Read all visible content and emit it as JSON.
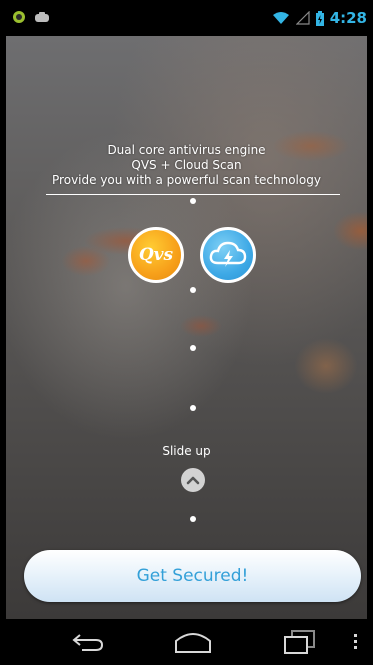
{
  "status_bar": {
    "time": "4:28",
    "icons": [
      "android-notification-icon",
      "controller-notification-icon",
      "wifi-icon",
      "signal-icon",
      "battery-icon"
    ]
  },
  "promo": {
    "line1": "Dual core antivirus engine",
    "line2": "QVS + Cloud Scan",
    "line3": "Provide you with a powerful scan technology"
  },
  "logos": {
    "qvs_label": "Qvs",
    "cloud_icon": "cloud-lightning-icon"
  },
  "slide": {
    "label": "Slide up",
    "icon": "chevron-up-icon"
  },
  "cta": {
    "label": "Get Secured!"
  },
  "navigation": {
    "icons": [
      "back-icon",
      "home-icon",
      "recent-apps-icon",
      "menu-icon"
    ]
  },
  "colors": {
    "accent": "#33b5e5",
    "qvs_orange": "#f7a01a",
    "cloud_blue": "#3ea9e6",
    "button_text": "#33a0d8"
  }
}
